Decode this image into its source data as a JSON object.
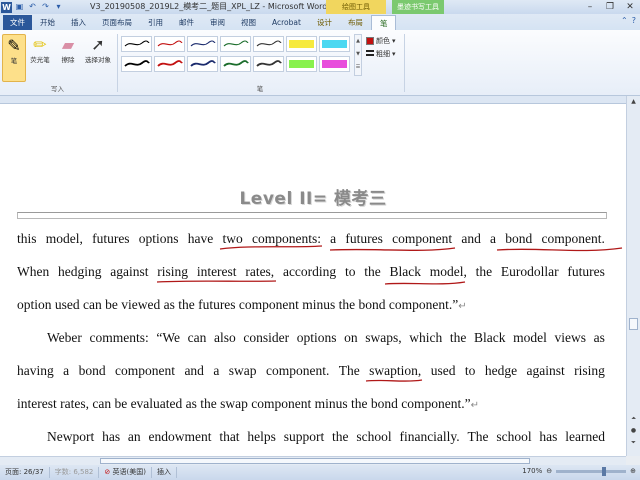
{
  "window": {
    "title": "V3_20190508_2019L2_模考二_题目_XPL_LZ - Microsoft Word",
    "context_groups": [
      "绘图工具",
      "墨迹书写工具"
    ],
    "controls": [
      "–",
      "❐",
      "✕"
    ]
  },
  "tabs": [
    "文件",
    "开始",
    "插入",
    "页面布局",
    "引用",
    "邮件",
    "审阅",
    "视图",
    "Acrobat",
    "设计",
    "布局",
    "笔"
  ],
  "ribbon": {
    "tools": {
      "pen": "笔",
      "highlighter": "荧光笔",
      "eraser": "擦除",
      "select": "选择对象"
    },
    "options": {
      "color": "颜色",
      "thickness": "粗细"
    },
    "groups": {
      "write": "写入",
      "pens": "笔"
    },
    "pen_colors": [
      "#000000",
      "#c21010",
      "#1a2a6c",
      "#1a6c2a",
      "#333333",
      "#f5e82a",
      "#39d4f0",
      "#000000",
      "#c21010",
      "#1a2a6c",
      "#1a6c2a",
      "#333333",
      "#7cf03a",
      "#e63ad8"
    ]
  },
  "document": {
    "header_title": "Level II= 模考三",
    "lines": [
      [
        "this",
        "model,",
        "futures",
        "options",
        "have",
        "two",
        "components:",
        "a",
        "futures",
        "component",
        "and",
        "a",
        "bond",
        "component."
      ],
      [
        "When",
        "hedging",
        "against",
        "rising",
        "interest",
        "rates,",
        "according",
        "to",
        "the",
        "Black",
        "model,",
        "the",
        "Eurodollar",
        "futures"
      ],
      [
        "option used can be viewed as the futures component minus the bond component.”"
      ],
      [
        "Weber",
        "comments:",
        "“We",
        "can",
        "also",
        "consider",
        "options",
        "on",
        "swaps,",
        "which",
        "the",
        "Black",
        "model",
        "views",
        "as"
      ],
      [
        "having",
        "a",
        "bond",
        "component",
        "and",
        "a",
        "swap",
        "component.",
        "The",
        "swaption,",
        "used",
        "to",
        "hedge",
        "against",
        "rising"
      ],
      [
        "interest rates, can be evaluated as the swap component minus the bond component.”"
      ],
      [
        "Newport",
        "has",
        "an",
        "endowment",
        "that",
        "helps",
        "support",
        "the",
        "school",
        "financially.",
        "The",
        "school",
        "has",
        "learned"
      ]
    ],
    "paragraph_mark": "↵"
  },
  "statusbar": {
    "page": "页面: 26/37",
    "words": "字数: 6,582",
    "language": "英语(美国)",
    "mode": "插入",
    "zoom": "170%",
    "zoom_minus": "⊖",
    "zoom_plus": "⊕"
  }
}
